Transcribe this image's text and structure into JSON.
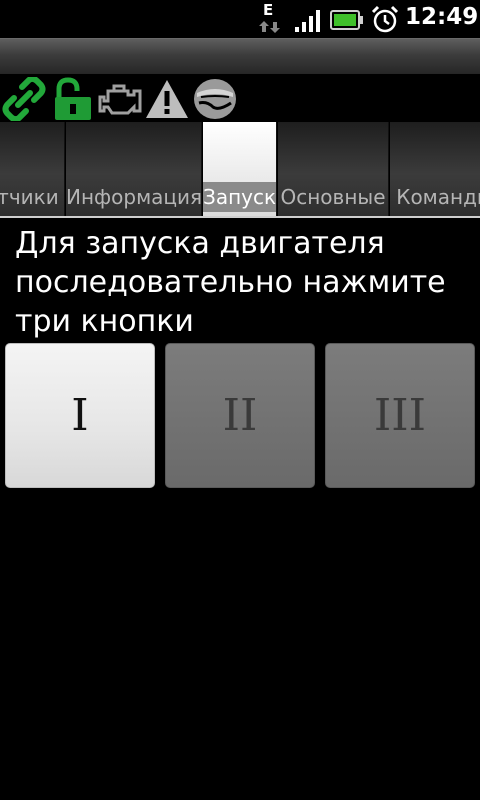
{
  "status_bar": {
    "network_type": "E",
    "time": "12:49",
    "icons": [
      "data-arrows-icon",
      "signal-icon",
      "battery-icon",
      "alarm-clock-icon"
    ]
  },
  "toolbar_icons": [
    {
      "name": "link-icon",
      "color": "#22a83a"
    },
    {
      "name": "unlock-icon",
      "color": "#22a83a"
    },
    {
      "name": "engine-icon",
      "color": "#9a9a9a"
    },
    {
      "name": "warning-icon",
      "color": "#bdbdbd"
    },
    {
      "name": "car-shield-icon",
      "color": "#9a9a9a"
    }
  ],
  "tabs": [
    {
      "label": "Датчики",
      "active": false
    },
    {
      "label": "Информация",
      "active": false
    },
    {
      "label": "Запуск",
      "active": true
    },
    {
      "label": "Основные",
      "active": false
    },
    {
      "label": "Команды",
      "active": false
    }
  ],
  "instruction": "Для запуска двигателя последовательно нажмите три кнопки",
  "step_buttons": [
    {
      "label": "I",
      "enabled": true
    },
    {
      "label": "II",
      "enabled": false
    },
    {
      "label": "III",
      "enabled": false
    }
  ],
  "colors": {
    "background": "#000000",
    "accent_green": "#22a83a",
    "active_tab": "#ececec",
    "enabled_button": "#e8e8e8",
    "disabled_button": "#747474"
  }
}
